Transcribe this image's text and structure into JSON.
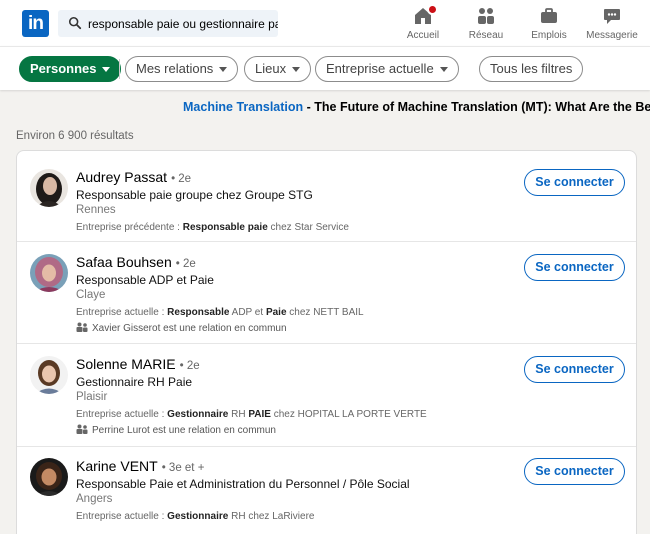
{
  "nav": {
    "logo_text": "in",
    "search_value": "responsable paie ou gestionnaire paie",
    "items": [
      {
        "label": "Accueil",
        "icon": "home-icon"
      },
      {
        "label": "Réseau",
        "icon": "network-icon"
      },
      {
        "label": "Emplois",
        "icon": "briefcase-icon"
      },
      {
        "label": "Messagerie",
        "icon": "messaging-icon"
      }
    ]
  },
  "filters": {
    "people": "Personnes",
    "connections": "Mes relations",
    "locations": "Lieux",
    "current_company": "Entreprise actuelle",
    "all_filters": "Tous les filtres"
  },
  "ad": {
    "brand": "Machine Translation",
    "sep": " - ",
    "text": "The Future of Machine Translation (MT): What Are the Benefits"
  },
  "results_count": "Environ 6 900 résultats",
  "results": [
    {
      "name": "Audrey Passat",
      "degree": "• 2e",
      "title": "Responsable paie groupe chez Groupe STG",
      "location": "Rennes",
      "detail_prefix": "Entreprise précédente  : ",
      "detail_bold_1": "Responsable paie",
      "detail_mid": " chez Star Service",
      "detail_bold_2": "",
      "detail_end": "",
      "mutual": "",
      "connect": "Se connecter"
    },
    {
      "name": "Safaa Bouhsen",
      "degree": "• 2e",
      "title": "Responsable ADP et Paie",
      "location": "Claye",
      "detail_prefix": "Entreprise actuelle  : ",
      "detail_bold_1": "Responsable",
      "detail_mid": " ADP et ",
      "detail_bold_2": "Paie",
      "detail_end": " chez NETT BAIL",
      "mutual": "Xavier Gisserot est une relation en commun",
      "connect": "Se connecter"
    },
    {
      "name": "Solenne MARIE",
      "degree": "• 2e",
      "title": "Gestionnaire RH Paie",
      "location": "Plaisir",
      "detail_prefix": "Entreprise actuelle  : ",
      "detail_bold_1": "Gestionnaire",
      "detail_mid": " RH ",
      "detail_bold_2": "PAIE",
      "detail_end": " chez HOPITAL LA PORTE VERTE",
      "mutual": "Perrine Lurot est une relation en commun",
      "connect": "Se connecter"
    },
    {
      "name": "Karine VENT",
      "degree": "• 3e et +",
      "title": "Responsable Paie et Administration du Personnel / Pôle Social",
      "location": "Angers",
      "detail_prefix": "Entreprise actuelle  : ",
      "detail_bold_1": "Gestionnaire",
      "detail_mid": " RH chez LaRiviere",
      "detail_bold_2": "",
      "detail_end": "",
      "mutual": "",
      "connect": "Se connecter"
    }
  ],
  "colors": {
    "brand_blue": "#0a66c2",
    "active_green": "#057642",
    "notification_red": "#cc1016"
  }
}
